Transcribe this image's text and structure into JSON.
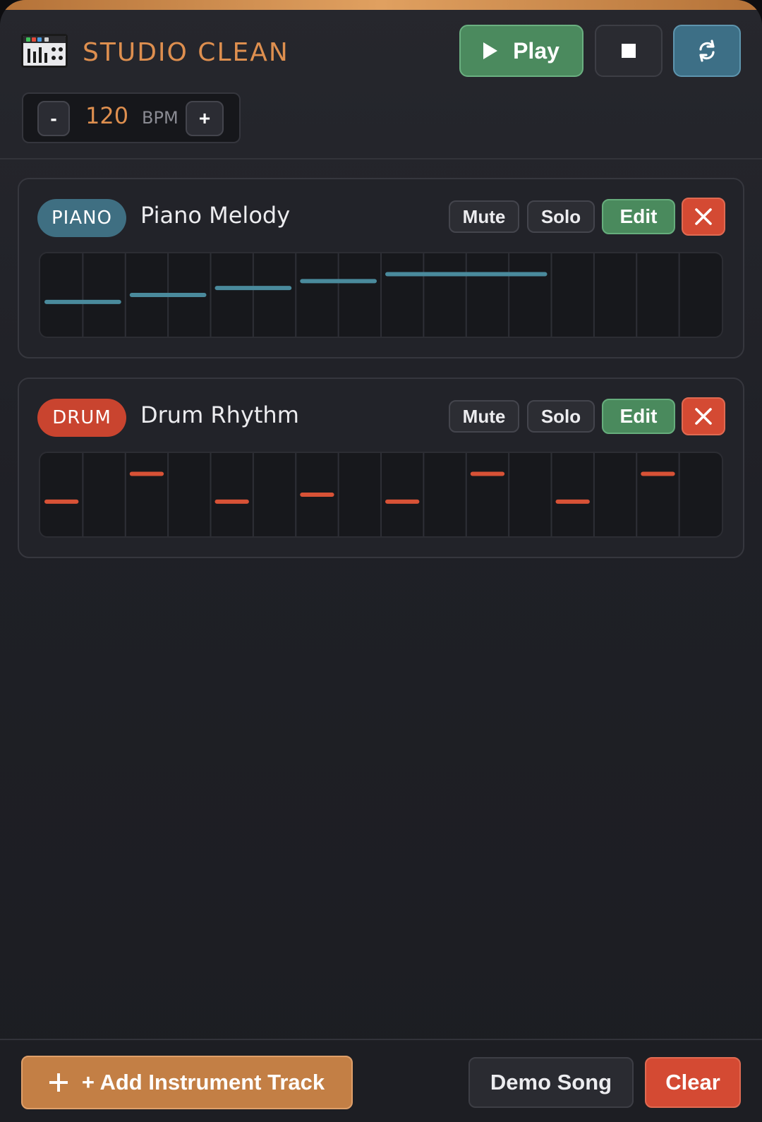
{
  "header": {
    "app_title": "STUDIO CLEAN",
    "logo_icon": "mixer-console-icon",
    "play_label": "Play",
    "stop_icon": "stop-icon",
    "loop_icon": "loop-icon"
  },
  "bpm": {
    "minus_label": "-",
    "value": "120",
    "unit": "BPM",
    "plus_label": "+"
  },
  "tracks": [
    {
      "badge": "PIANO",
      "name": "Piano Melody",
      "mute_label": "Mute",
      "solo_label": "Solo",
      "edit_label": "Edit",
      "color": "#3f6f82",
      "note_color": "#4a8a9c",
      "steps": 16,
      "rows": 12,
      "notes": [
        {
          "start": 0,
          "length": 2,
          "pitch": 1
        },
        {
          "start": 2,
          "length": 2,
          "pitch": 2
        },
        {
          "start": 4,
          "length": 2,
          "pitch": 3
        },
        {
          "start": 6,
          "length": 2,
          "pitch": 4
        },
        {
          "start": 8,
          "length": 4,
          "pitch": 5
        }
      ]
    },
    {
      "badge": "DRUM",
      "name": "Drum Rhythm",
      "mute_label": "Mute",
      "solo_label": "Solo",
      "edit_label": "Edit",
      "color": "#c9442f",
      "note_color": "#d85236",
      "steps": 16,
      "rows": 12,
      "notes": [
        {
          "start": 0,
          "length": 1,
          "pitch": 1
        },
        {
          "start": 2,
          "length": 1,
          "pitch": 5
        },
        {
          "start": 4,
          "length": 1,
          "pitch": 1
        },
        {
          "start": 6,
          "length": 1,
          "pitch": 2
        },
        {
          "start": 8,
          "length": 1,
          "pitch": 1
        },
        {
          "start": 10,
          "length": 1,
          "pitch": 5
        },
        {
          "start": 12,
          "length": 1,
          "pitch": 1
        },
        {
          "start": 14,
          "length": 1,
          "pitch": 5
        }
      ]
    }
  ],
  "footer": {
    "add_track_label": "+ Add Instrument Track",
    "demo_label": "Demo Song",
    "clear_label": "Clear"
  },
  "colors": {
    "accent": "#de8f4f",
    "play_green": "#4b8a5e",
    "loop_teal": "#3d6f86",
    "danger_red": "#d44a33"
  }
}
